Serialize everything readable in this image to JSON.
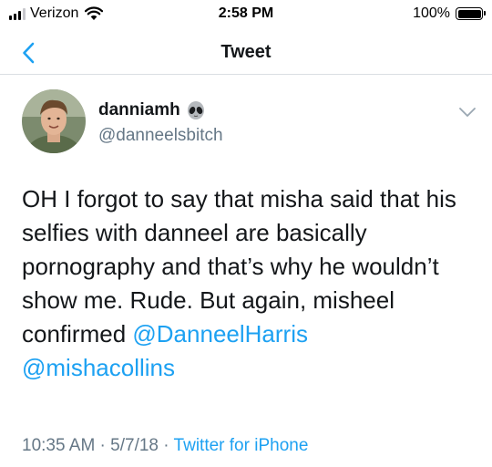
{
  "status_bar": {
    "carrier": "Verizon",
    "time": "2:58 PM",
    "battery": "100%",
    "icons": [
      "signal-icon",
      "wifi-icon",
      "battery-icon"
    ]
  },
  "nav": {
    "title": "Tweet",
    "back_icon": "chevron-left-icon"
  },
  "tweet": {
    "author": {
      "display_name": "danniamh",
      "emoji": "alien-face-icon",
      "handle": "@danneelsbitch"
    },
    "text_part1": "OH I forgot to say that misha said that his selfies with danneel are basically pornography and that’s why he wouldn’t show me. Rude. But again, misheel confirmed ",
    "mention1": "@DanneelHarris",
    "mention2": "@mishacollins",
    "time": "10:35 AM",
    "separator": " · ",
    "date": "5/7/18",
    "source": "Twitter for iPhone"
  },
  "colors": {
    "accent": "#1da1f2",
    "text": "#14171a",
    "secondary_text": "#657786",
    "divider": "#dadfe3"
  }
}
